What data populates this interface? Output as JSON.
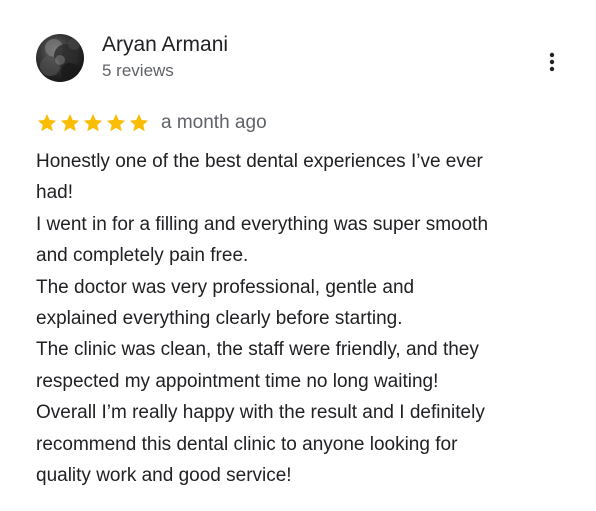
{
  "review": {
    "author_name": "Aryan Armani",
    "review_count": "5 reviews",
    "rating": 5,
    "rating_max": 5,
    "time": "a month ago",
    "more_icon": "more-vertical-icon",
    "star_color": "#fbbc04",
    "text_lines": [
      "Honestly one of the best dental experiences I’ve ever",
      "had!",
      "I went in for a filling and everything was super smooth",
      "and completely pain free.",
      "The doctor was very professional, gentle and",
      "explained everything clearly before starting.",
      "The clinic was clean, the staff were friendly, and they",
      "respected my appointment time no long waiting!",
      "Overall I’m really happy with the result and I definitely",
      "recommend this dental clinic to anyone looking for",
      "quality work and good service!"
    ]
  }
}
